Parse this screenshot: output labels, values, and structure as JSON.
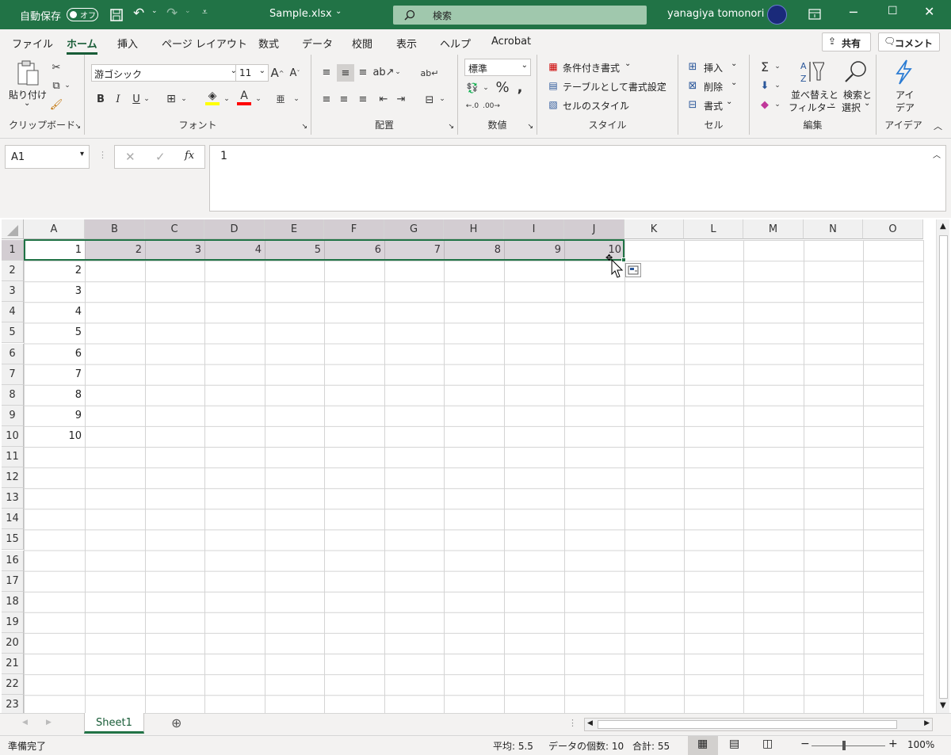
{
  "titlebar": {
    "autosave_label": "自動保存",
    "autosave_state": "オフ",
    "filename": "Sample.xlsx",
    "search_placeholder": "検索",
    "username": "yanagiya tomonori"
  },
  "tabs": [
    "ファイル",
    "ホーム",
    "挿入",
    "ページ レイアウト",
    "数式",
    "データ",
    "校閲",
    "表示",
    "ヘルプ",
    "Acrobat"
  ],
  "active_tab": "ホーム",
  "share_label": "共有",
  "comment_label": "コメント",
  "ribbon": {
    "clipboard": {
      "paste_label": "貼り付け",
      "group_label": "クリップボード"
    },
    "font": {
      "font_name": "游ゴシック",
      "font_size": "11",
      "group_label": "フォント"
    },
    "alignment": {
      "group_label": "配置"
    },
    "number": {
      "format": "標準",
      "group_label": "数値"
    },
    "styles": {
      "conditional": "条件付き書式",
      "table": "テーブルとして書式設定",
      "cell_styles": "セルのスタイル",
      "group_label": "スタイル"
    },
    "cells": {
      "insert": "挿入",
      "delete": "削除",
      "format": "書式",
      "group_label": "セル"
    },
    "editing": {
      "sort_line1": "並べ替えと",
      "sort_line2": "フィルター",
      "find_line1": "検索と",
      "find_line2": "選択",
      "group_label": "編集"
    },
    "ideas": {
      "line1": "アイ",
      "line2": "デア",
      "group_label": "アイデア"
    }
  },
  "formula_bar": {
    "name_box": "A1",
    "formula": "1"
  },
  "columns": [
    "A",
    "B",
    "C",
    "D",
    "E",
    "F",
    "G",
    "H",
    "I",
    "J",
    "K",
    "L",
    "M",
    "N",
    "O"
  ],
  "rows": [
    "1",
    "2",
    "3",
    "4",
    "5",
    "6",
    "7",
    "8",
    "9",
    "10",
    "11",
    "12",
    "13",
    "14",
    "15",
    "16",
    "17",
    "18",
    "19",
    "20",
    "21",
    "22",
    "23"
  ],
  "row1_values": [
    "1",
    "2",
    "3",
    "4",
    "5",
    "6",
    "7",
    "8",
    "9",
    "10"
  ],
  "colA_values": [
    "2",
    "3",
    "4",
    "5",
    "6",
    "7",
    "8",
    "9",
    "10"
  ],
  "sheet_tab": "Sheet1",
  "status": {
    "ready": "準備完了",
    "average": "平均: 5.5",
    "count": "データの個数: 10",
    "sum": "合計: 55",
    "zoom": "100%"
  },
  "colors": {
    "accent": "#217346",
    "selection": "#d3cdd2",
    "active_border": "#217346"
  }
}
